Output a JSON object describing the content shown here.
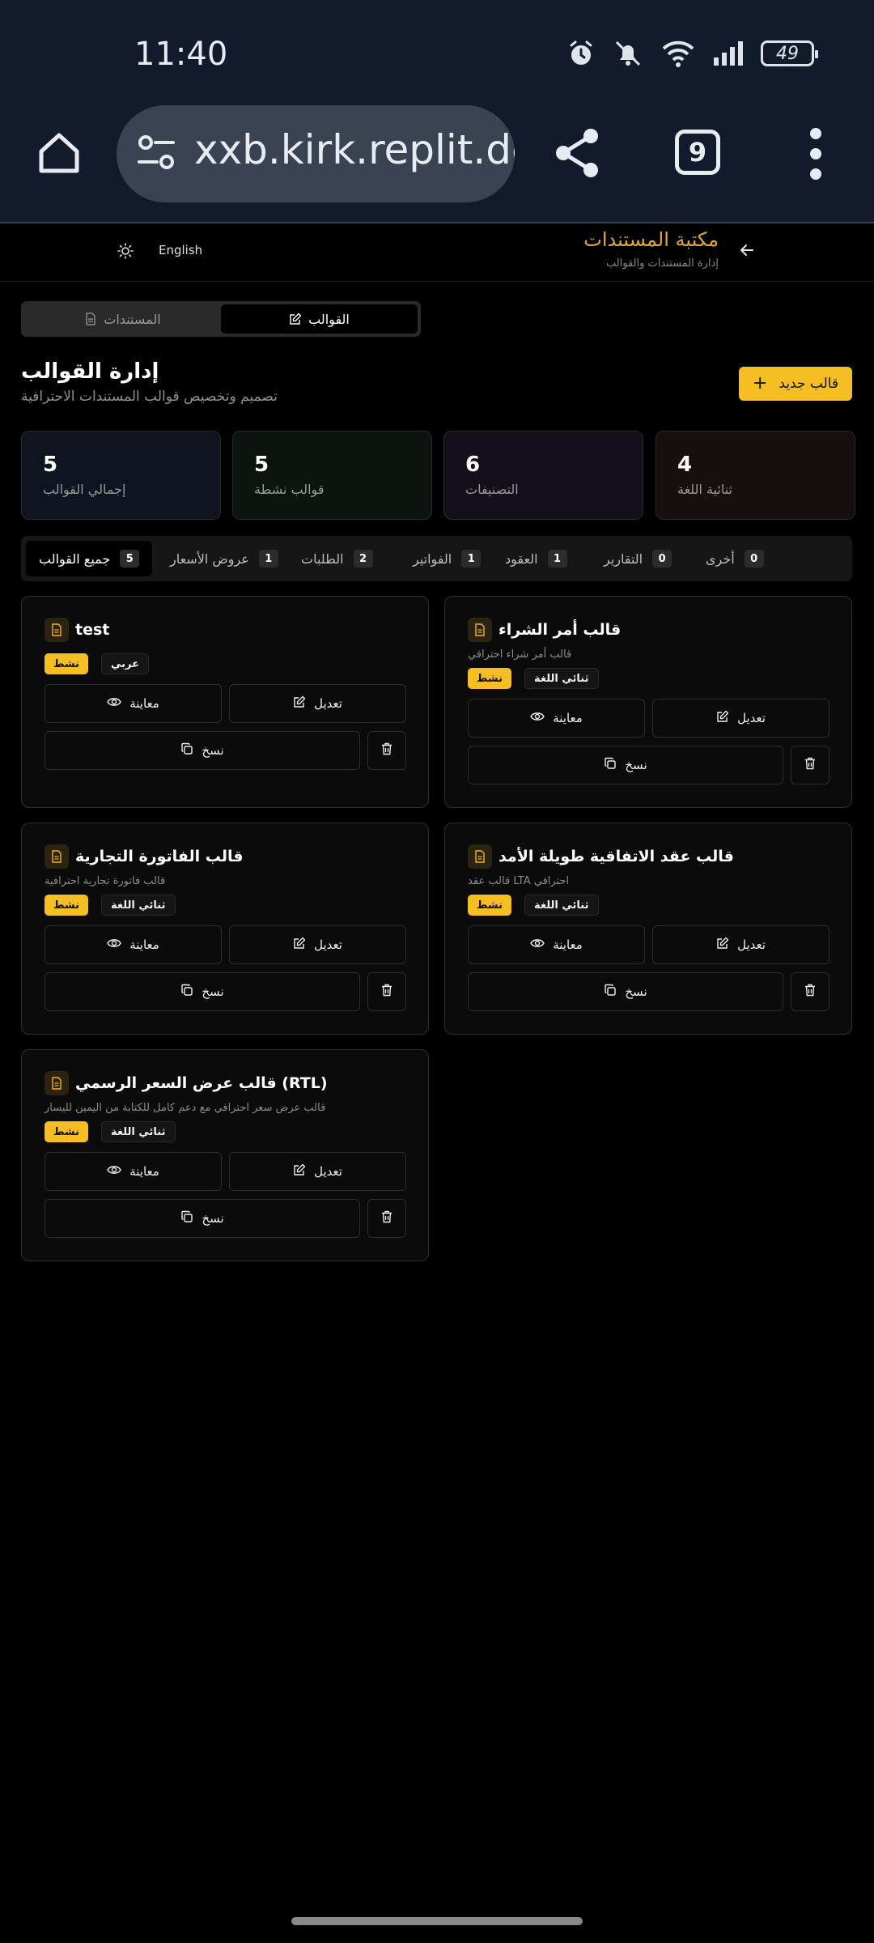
{
  "status_bar": {
    "time": "11:40",
    "battery": "49"
  },
  "browser": {
    "url": "xxb.kirk.replit.dev",
    "tab_count": "9"
  },
  "header": {
    "title": "مكتبة المستندات",
    "subtitle": "إدارة المستندات والقوالب",
    "language_label": "English"
  },
  "switcher": {
    "templates": "القوالب",
    "documents": "المستندات"
  },
  "page": {
    "title": "إدارة القوالب",
    "subtitle": "تصميم وتخصيص قوالب المستندات الاحترافية",
    "new_button": "قالب جديد"
  },
  "stats": [
    {
      "value": "5",
      "label": "إجمالي القوالب",
      "tint": "#0f1420"
    },
    {
      "value": "5",
      "label": "قوالب نشطة",
      "tint": "#0d130f"
    },
    {
      "value": "6",
      "label": "التصنيفات",
      "tint": "#150f1c"
    },
    {
      "value": "4",
      "label": "ثنائية اللغة",
      "tint": "#160f0d"
    }
  ],
  "filters": [
    {
      "label": "جميع القوالب",
      "count": "5",
      "active": true
    },
    {
      "label": "عروض الأسعار",
      "count": "1"
    },
    {
      "label": "الطلبات",
      "count": "2"
    },
    {
      "label": "الفواتير",
      "count": "1"
    },
    {
      "label": "العقود",
      "count": "1"
    },
    {
      "label": "التقارير",
      "count": "0"
    },
    {
      "label": "أخرى",
      "count": "0"
    }
  ],
  "actions": {
    "edit": "تعديل",
    "preview": "معاينة",
    "copy": "نسخ"
  },
  "templates": [
    {
      "title": "قالب أمر الشراء",
      "description": "قالب أمر شراء احترافي",
      "status": "نشط",
      "language": "ثنائي اللغة"
    },
    {
      "title": "test",
      "description": "",
      "status": "نشط",
      "language": "عربي"
    },
    {
      "title": "قالب عقد الاتفاقية طويلة الأمد",
      "description": "قالب عقد LTA احترافي",
      "status": "نشط",
      "language": "ثنائي اللغة"
    },
    {
      "title": "قالب الفاتورة التجارية",
      "description": "قالب فاتورة تجارية احترافية",
      "status": "نشط",
      "language": "ثنائي اللغة"
    },
    {
      "title": "قالب عرض السعر الرسمي (RTL)",
      "description": "قالب عرض سعر احترافي مع دعم كامل للكتابة من اليمين لليسار",
      "status": "نشط",
      "language": "ثنائي اللغة"
    }
  ]
}
